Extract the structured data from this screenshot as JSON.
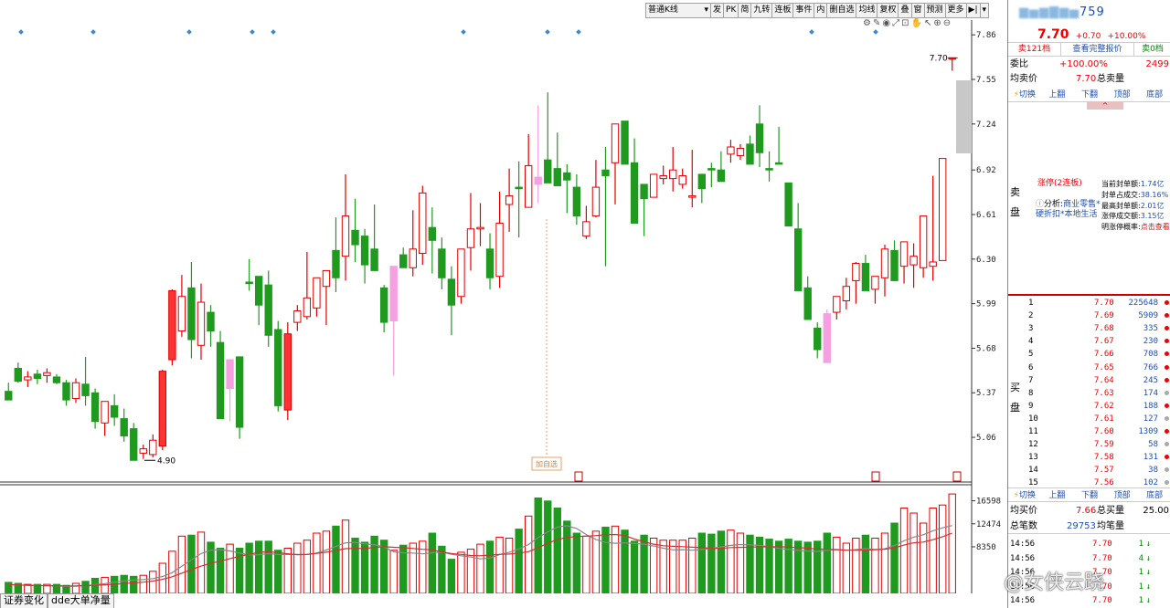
{
  "toolbar": {
    "period": "普通K线",
    "buttons": [
      "发",
      "PK",
      "简",
      "九转",
      "连板",
      "事件",
      "内",
      "删自选",
      "均线",
      "复权",
      "叠",
      "窗",
      "预测",
      "更多"
    ]
  },
  "chart": {
    "price_axis": [
      "7.86",
      "7.55",
      "7.24",
      "6.92",
      "6.61",
      "6.30",
      "5.99",
      "5.68",
      "5.37",
      "5.06"
    ],
    "price_range": [
      4.8,
      7.95
    ],
    "volume_axis": [
      "16598",
      "12474",
      "8350"
    ],
    "high_label": "7.70",
    "low_label": "4.90",
    "tag_label": "加自选",
    "colors": {
      "up": "#e00000",
      "down": "#1f9a1f",
      "limit_up": "#ff3333",
      "pink": "#f5a0e0",
      "ma5": "#888888",
      "ma10": "#cc3333"
    }
  },
  "chart_data": {
    "type": "candlestick",
    "ohlc": [
      [
        5.38,
        5.44,
        5.33,
        5.32
      ],
      [
        5.54,
        5.58,
        5.44,
        5.45
      ],
      [
        5.46,
        5.52,
        5.41,
        5.48
      ],
      [
        5.5,
        5.53,
        5.43,
        5.47
      ],
      [
        5.49,
        5.54,
        5.44,
        5.51
      ],
      [
        5.48,
        5.5,
        5.43,
        5.44
      ],
      [
        5.44,
        5.46,
        5.28,
        5.32
      ],
      [
        5.33,
        5.47,
        5.3,
        5.44
      ],
      [
        5.43,
        5.62,
        5.28,
        5.35
      ],
      [
        5.37,
        5.4,
        5.12,
        5.17
      ],
      [
        5.16,
        5.31,
        5.07,
        5.31
      ],
      [
        5.28,
        5.36,
        5.14,
        5.2
      ],
      [
        5.19,
        5.26,
        5.03,
        5.07
      ],
      [
        5.12,
        5.16,
        4.9,
        4.9
      ],
      [
        4.95,
        5.01,
        4.91,
        4.98
      ],
      [
        4.94,
        5.08,
        4.92,
        5.04
      ],
      [
        5.0,
        5.53,
        4.97,
        5.52
      ],
      [
        5.6,
        6.09,
        5.56,
        6.08
      ],
      [
        5.8,
        6.19,
        5.76,
        6.04
      ],
      [
        6.1,
        6.28,
        5.61,
        5.74
      ],
      [
        5.7,
        6.13,
        5.6,
        6.0
      ],
      [
        5.93,
        5.98,
        5.69,
        5.8
      ],
      [
        5.72,
        5.8,
        5.19,
        5.19
      ],
      [
        5.4,
        5.4,
        5.17,
        5.6
      ],
      [
        5.62,
        5.62,
        5.05,
        5.13
      ],
      [
        6.14,
        6.3,
        6.08,
        6.13
      ],
      [
        6.18,
        6.18,
        5.84,
        5.98
      ],
      [
        6.12,
        6.22,
        5.69,
        5.77
      ],
      [
        5.81,
        5.87,
        5.24,
        5.28
      ],
      [
        5.25,
        5.86,
        5.18,
        5.78
      ],
      [
        5.86,
        5.98,
        5.8,
        5.94
      ],
      [
        5.9,
        6.35,
        5.88,
        6.03
      ],
      [
        5.96,
        6.15,
        5.9,
        6.17
      ],
      [
        6.11,
        6.21,
        5.84,
        6.22
      ],
      [
        6.36,
        6.59,
        6.07,
        6.17
      ],
      [
        6.32,
        6.89,
        6.15,
        6.6
      ],
      [
        6.5,
        6.72,
        6.28,
        6.4
      ],
      [
        6.46,
        6.51,
        6.13,
        6.26
      ],
      [
        6.37,
        6.68,
        6.27,
        6.22
      ],
      [
        6.1,
        6.12,
        5.79,
        5.86
      ],
      [
        5.87,
        5.91,
        5.49,
        6.25
      ],
      [
        6.33,
        6.38,
        6.31,
        6.24
      ],
      [
        6.24,
        6.64,
        6.18,
        6.37
      ],
      [
        6.34,
        6.81,
        6.26,
        6.76
      ],
      [
        6.52,
        6.66,
        6.2,
        6.43
      ],
      [
        6.37,
        6.45,
        6.09,
        6.17
      ],
      [
        6.16,
        6.25,
        5.77,
        5.98
      ],
      [
        6.04,
        6.36,
        5.99,
        6.37
      ],
      [
        6.38,
        6.76,
        6.22,
        6.51
      ],
      [
        6.51,
        6.69,
        6.39,
        6.52
      ],
      [
        6.37,
        6.48,
        6.09,
        6.17
      ],
      [
        6.18,
        6.77,
        6.1,
        6.55
      ],
      [
        6.68,
        6.93,
        6.49,
        6.74
      ],
      [
        6.8,
        6.98,
        6.45,
        6.79
      ],
      [
        6.66,
        7.17,
        6.66,
        6.95
      ],
      [
        6.87,
        7.37,
        6.69,
        6.82
      ],
      [
        6.99,
        7.46,
        6.95,
        6.83
      ],
      [
        6.93,
        7.18,
        6.83,
        6.81
      ],
      [
        6.9,
        6.96,
        6.62,
        6.85
      ],
      [
        6.8,
        6.89,
        6.54,
        6.6
      ],
      [
        6.46,
        6.67,
        6.44,
        6.56
      ],
      [
        6.6,
        6.99,
        6.59,
        6.8
      ],
      [
        6.92,
        7.08,
        6.25,
        6.88
      ],
      [
        6.97,
        7.21,
        6.68,
        7.24
      ],
      [
        7.26,
        7.12,
        6.97,
        6.96
      ],
      [
        6.97,
        7.14,
        6.58,
        6.55
      ],
      [
        6.82,
        6.81,
        6.46,
        6.72
      ],
      [
        6.73,
        6.89,
        6.87,
        6.89
      ],
      [
        6.86,
        6.95,
        6.82,
        6.88
      ],
      [
        6.86,
        7.08,
        6.77,
        6.92
      ],
      [
        6.82,
        6.93,
        6.79,
        6.88
      ],
      [
        6.73,
        7.06,
        6.66,
        6.74
      ],
      [
        6.89,
        6.89,
        6.69,
        6.79
      ],
      [
        6.93,
        6.97,
        6.8,
        6.92
      ],
      [
        6.92,
        7.05,
        6.89,
        6.84
      ],
      [
        7.03,
        7.13,
        6.97,
        7.08
      ],
      [
        7.02,
        7.1,
        6.99,
        7.07
      ],
      [
        7.1,
        7.16,
        6.96,
        6.96
      ],
      [
        7.24,
        7.37,
        6.94,
        7.04
      ],
      [
        6.93,
        7.05,
        6.84,
        6.92
      ],
      [
        6.97,
        7.22,
        6.97,
        6.96
      ],
      [
        6.83,
        6.82,
        6.6,
        6.53
      ],
      [
        6.51,
        6.69,
        6.08,
        6.08
      ],
      [
        6.1,
        6.18,
        5.88,
        5.88
      ],
      [
        5.82,
        5.86,
        5.61,
        5.67
      ],
      [
        5.92,
        5.95,
        5.62,
        5.58
      ],
      [
        5.93,
        5.99,
        5.88,
        6.04
      ],
      [
        6.01,
        6.17,
        5.95,
        6.11
      ],
      [
        6.15,
        6.28,
        5.99,
        6.27
      ],
      [
        6.27,
        6.33,
        6.09,
        6.08
      ],
      [
        6.09,
        6.14,
        5.99,
        6.18
      ],
      [
        6.17,
        6.4,
        6.04,
        6.37
      ],
      [
        6.36,
        6.43,
        6.19,
        6.15
      ],
      [
        6.25,
        6.32,
        6.13,
        6.42
      ],
      [
        6.26,
        6.41,
        6.1,
        6.32
      ],
      [
        6.24,
        6.47,
        6.17,
        6.6
      ],
      [
        6.25,
        6.88,
        6.15,
        6.28
      ],
      [
        6.29,
        7.0,
        6.29,
        7.0
      ],
      [
        7.7,
        7.7,
        7.61,
        7.7
      ]
    ],
    "volume": [
      11,
      10,
      9,
      9,
      9,
      9,
      8,
      10,
      12,
      15,
      16,
      17,
      18,
      17,
      18,
      22,
      30,
      42,
      57,
      58,
      61,
      51,
      45,
      49,
      45,
      50,
      52,
      52,
      43,
      45,
      50,
      53,
      60,
      62,
      67,
      73,
      55,
      51,
      57,
      53,
      43,
      48,
      50,
      52,
      60,
      47,
      34,
      41,
      44,
      49,
      52,
      56,
      55,
      64,
      77,
      95,
      92,
      85,
      72,
      60,
      57,
      62,
      66,
      67,
      63,
      52,
      58,
      55,
      53,
      53,
      53,
      55,
      60,
      59,
      62,
      63,
      60,
      58,
      56,
      54,
      52,
      54,
      52,
      51,
      52,
      60,
      56,
      50,
      55,
      58,
      55,
      60,
      70,
      85,
      80,
      70,
      85,
      88,
      99,
      70
    ],
    "price_axis_range": [
      4.8,
      7.95
    ],
    "volume_axis_max": 18000
  },
  "panel": {
    "stock_name_suffix": "759",
    "price": "7.70",
    "change": "+0.70",
    "change_pct": "+10.00%",
    "btn_sell": "卖121档",
    "btn_full": "查看完整报价",
    "btn_buy": "卖0档",
    "weibi_label": "委比",
    "weibi_value": "+100.00%",
    "weibi_right": "2499",
    "avg_sell_label": "均卖价",
    "avg_sell_value": "7.70",
    "total_sell_label": "总卖量",
    "nav": [
      "切换",
      "上翻",
      "下翻",
      "顶部",
      "底部"
    ],
    "sell_label": "卖盘",
    "limit_title": "涨停(2连板)",
    "limit_analysis_label": "分析:",
    "limit_analysis_value": "商业零售*硬折扣*本地生活",
    "limit_stats": [
      [
        "当前封单额:",
        "1.74亿"
      ],
      [
        "封单占成交:",
        "38.16%"
      ],
      [
        "最高封单额:",
        "2.01亿"
      ],
      [
        "涨停成交额:",
        "3.15亿"
      ],
      [
        "明涨停概率:",
        "点击查看"
      ]
    ],
    "buy_label": "买盘",
    "bids": [
      [
        "1",
        "7.70",
        "225648",
        "#e00"
      ],
      [
        "2",
        "7.69",
        "5909",
        "#e00"
      ],
      [
        "3",
        "7.68",
        "335",
        "#e00"
      ],
      [
        "4",
        "7.67",
        "230",
        "#e00"
      ],
      [
        "5",
        "7.66",
        "708",
        "#e00"
      ],
      [
        "6",
        "7.65",
        "766",
        "#e00"
      ],
      [
        "7",
        "7.64",
        "245",
        "#e00"
      ],
      [
        "8",
        "7.63",
        "174",
        "#aaa"
      ],
      [
        "9",
        "7.62",
        "188",
        "#e00"
      ],
      [
        "10",
        "7.61",
        "127",
        "#aaa"
      ],
      [
        "11",
        "7.60",
        "1309",
        "#e00"
      ],
      [
        "12",
        "7.59",
        "58",
        "#aaa"
      ],
      [
        "13",
        "7.58",
        "131",
        "#e00"
      ],
      [
        "14",
        "7.57",
        "38",
        "#aaa"
      ],
      [
        "15",
        "7.56",
        "102",
        "#aaa"
      ]
    ],
    "avg_buy_label": "均买价",
    "avg_buy_value": "7.66",
    "total_buy_label": "总买量",
    "total_buy_value": "25.00",
    "total_count_label": "总笔数",
    "total_count_value": "29753",
    "avg_vol_label": "均笔量",
    "ticks": [
      [
        "14:56",
        "7.70",
        "1",
        "↓"
      ],
      [
        "14:56",
        "7.70",
        "4",
        "↓"
      ],
      [
        "14:56",
        "7.70",
        "1",
        "↓"
      ],
      [
        "14:56",
        "7.70",
        "1",
        "↓"
      ],
      [
        "14:56",
        "7.70",
        "1",
        "↓"
      ]
    ]
  },
  "bottom_tabs": [
    "证券变化",
    "dde大单净量"
  ],
  "watermark": "@女侠云跷"
}
